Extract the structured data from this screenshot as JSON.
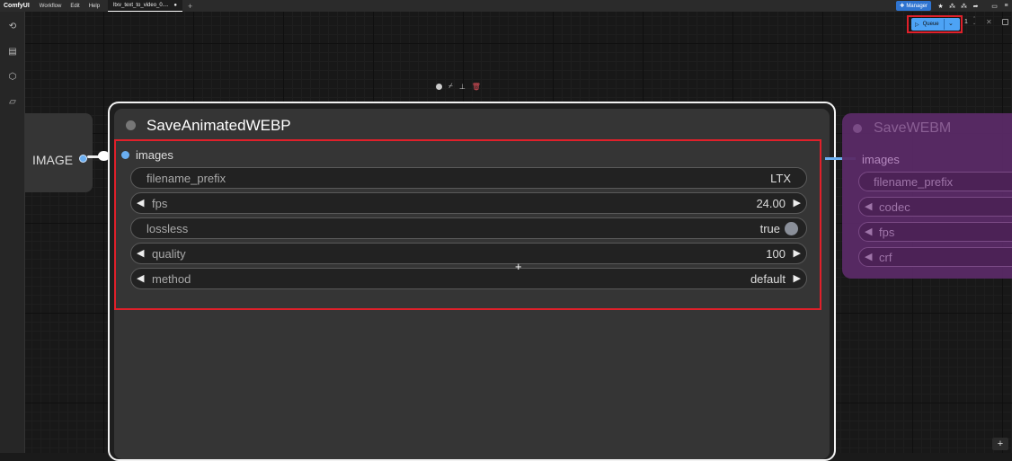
{
  "topbar": {
    "app_name": "ComfyUI",
    "menus": [
      "Workflow",
      "Edit",
      "Help"
    ],
    "active_tab": "ltxv_text_to_video_0....",
    "tab_modified_dot": "●",
    "new_tab": "+",
    "manager_label": "Manager"
  },
  "queue": {
    "label": "Queue",
    "count": "1"
  },
  "nodes": {
    "image_node": {
      "output_label": "IMAGE"
    },
    "save_webp": {
      "title": "SaveAnimatedWEBP",
      "input_label": "images",
      "widgets": [
        {
          "name": "filename_prefix",
          "value": "LTX"
        },
        {
          "name": "fps",
          "value": "24.00"
        },
        {
          "name": "lossless",
          "value": "true"
        },
        {
          "name": "quality",
          "value": "100"
        },
        {
          "name": "method",
          "value": "default"
        }
      ]
    },
    "save_webm": {
      "title": "SaveWEBM",
      "input_label": "images",
      "widgets": [
        "filename_prefix",
        "codec",
        "fps",
        "crf"
      ]
    }
  },
  "colors": {
    "accent": "#4da3f5",
    "highlight": "#e0202a",
    "webm_node": "#5a2a66"
  }
}
